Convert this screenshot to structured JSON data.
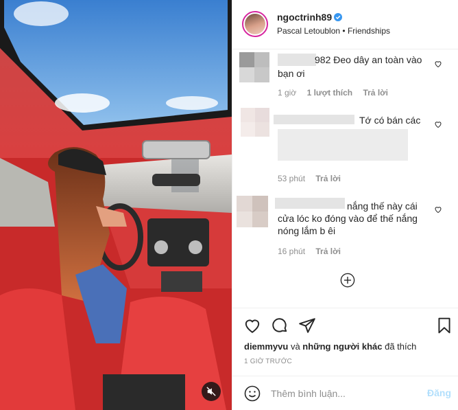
{
  "post": {
    "username": "ngoctrinh89",
    "audio": "Pascal Letoublon",
    "separator": "•",
    "song": "Friendships"
  },
  "comments": [
    {
      "text_line1": "982 Đeo dây an toàn vào",
      "text_line2": "bạn ơi",
      "time": "1 giờ",
      "likes": "1 lượt thích",
      "reply": "Trả lời"
    },
    {
      "text_line1": "Tớ có bán các",
      "time": "53 phút",
      "reply": "Trả lời"
    },
    {
      "text_line1": "nắng thế này cái",
      "text_line2": "cửa lóc ko đóng vào để thế nắng",
      "text_line3": "nóng lắm b êi",
      "time": "16 phút",
      "reply": "Trả lời"
    }
  ],
  "likes": {
    "user": "diemmyvu",
    "connector": "và",
    "others": "những người khác",
    "suffix": "đã thích"
  },
  "timestamp": "1 GIỜ TRƯỚC",
  "composer": {
    "placeholder": "Thêm bình luận...",
    "post_label": "Đăng"
  },
  "colors": {
    "verified": "#3897f0",
    "post_button_disabled": "#b2dffc",
    "meta_text": "#8e8e8e",
    "car_interior": "#c82a2a"
  },
  "icons": [
    "verified-badge-icon",
    "heart-icon",
    "add-comments-icon",
    "comment-icon",
    "share-icon",
    "save-icon",
    "emoji-icon",
    "muted-audio-icon"
  ]
}
